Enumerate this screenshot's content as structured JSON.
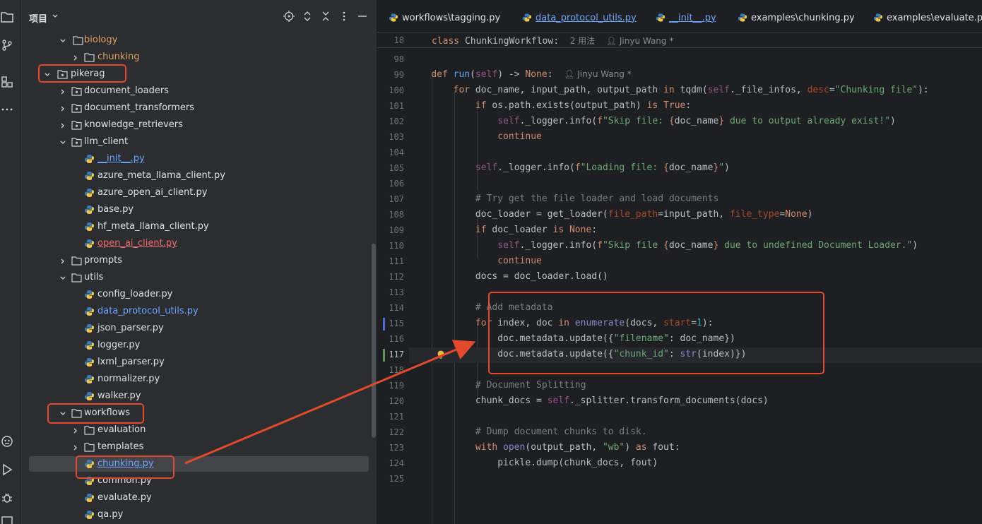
{
  "sidebar": {
    "title": "项目",
    "icons": [
      "folder-icon",
      "git-branch-icon",
      "structure-icon",
      "more-icon",
      "ai-assistant-icon",
      "run-icon",
      "debug-icon",
      "terminal-icon"
    ]
  },
  "tree": {
    "items": [
      {
        "label": "biology",
        "type": "folder",
        "expanded": true,
        "color": "orange"
      },
      {
        "label": "chunking",
        "type": "folder",
        "expanded": false,
        "color": "orange"
      },
      {
        "label": "pikerag",
        "type": "package",
        "expanded": true,
        "color": "default"
      },
      {
        "label": "document_loaders",
        "type": "package",
        "expanded": false,
        "color": "default"
      },
      {
        "label": "document_transformers",
        "type": "package",
        "expanded": false,
        "color": "default"
      },
      {
        "label": "knowledge_retrievers",
        "type": "package",
        "expanded": false,
        "color": "default"
      },
      {
        "label": "llm_client",
        "type": "package",
        "expanded": true,
        "color": "default"
      },
      {
        "label": "__init__.py",
        "type": "py",
        "color": "blue"
      },
      {
        "label": "azure_meta_llama_client.py",
        "type": "py",
        "color": "default"
      },
      {
        "label": "azure_open_ai_client.py",
        "type": "py",
        "color": "default"
      },
      {
        "label": "base.py",
        "type": "py",
        "color": "default"
      },
      {
        "label": "hf_meta_llama_client.py",
        "type": "py",
        "color": "default"
      },
      {
        "label": "open_ai_client.py",
        "type": "py",
        "color": "red"
      },
      {
        "label": "prompts",
        "type": "folder",
        "expanded": false,
        "color": "default"
      },
      {
        "label": "utils",
        "type": "folder",
        "expanded": true,
        "color": "default"
      },
      {
        "label": "config_loader.py",
        "type": "py",
        "color": "default"
      },
      {
        "label": "data_protocol_utils.py",
        "type": "py",
        "color": "blue"
      },
      {
        "label": "json_parser.py",
        "type": "py",
        "color": "default"
      },
      {
        "label": "logger.py",
        "type": "py",
        "color": "default"
      },
      {
        "label": "lxml_parser.py",
        "type": "py",
        "color": "default"
      },
      {
        "label": "normalizer.py",
        "type": "py",
        "color": "default"
      },
      {
        "label": "walker.py",
        "type": "py",
        "color": "default"
      },
      {
        "label": "workflows",
        "type": "folder",
        "expanded": true,
        "color": "default"
      },
      {
        "label": "evaluation",
        "type": "folder",
        "expanded": false,
        "color": "default"
      },
      {
        "label": "templates",
        "type": "folder",
        "expanded": false,
        "color": "default"
      },
      {
        "label": "chunking.py",
        "type": "py",
        "color": "blue",
        "selected": true
      },
      {
        "label": "common.py",
        "type": "py",
        "color": "default"
      },
      {
        "label": "evaluate.py",
        "type": "py",
        "color": "default"
      },
      {
        "label": "qa.py",
        "type": "py",
        "color": "default"
      }
    ]
  },
  "tabs": [
    {
      "label": "workflows\\tagging.py",
      "color": "default"
    },
    {
      "label": "data_protocol_utils.py",
      "color": "blue"
    },
    {
      "label": "__init__.py",
      "color": "blue"
    },
    {
      "label": "examples\\chunking.py",
      "color": "default"
    },
    {
      "label": "examples\\evaluate.py",
      "color": "default"
    }
  ],
  "sticky": {
    "line": "18",
    "class_kw": "class",
    "class_name": "ChunkingWorkflow:",
    "usages": "2 用法",
    "author": "Jinyu Wang *"
  },
  "code": {
    "line_numbers": [
      "98",
      "99",
      "100",
      "101",
      "102",
      "103",
      "104",
      "105",
      "106",
      "107",
      "108",
      "109",
      "110",
      "111",
      "112",
      "113",
      "114",
      "115",
      "116",
      "117",
      "118",
      "119",
      "120",
      "121",
      "122",
      "123",
      "124",
      "125"
    ],
    "run_meta": "Jinyu Wang *",
    "caret_line": "117",
    "colors": {
      "keyword": "#cf8e6d",
      "function": "#56a8f5",
      "string": "#6aab73",
      "comment": "#7a7e85",
      "number": "#2aacb8",
      "annotation": "#e24a2b"
    }
  }
}
